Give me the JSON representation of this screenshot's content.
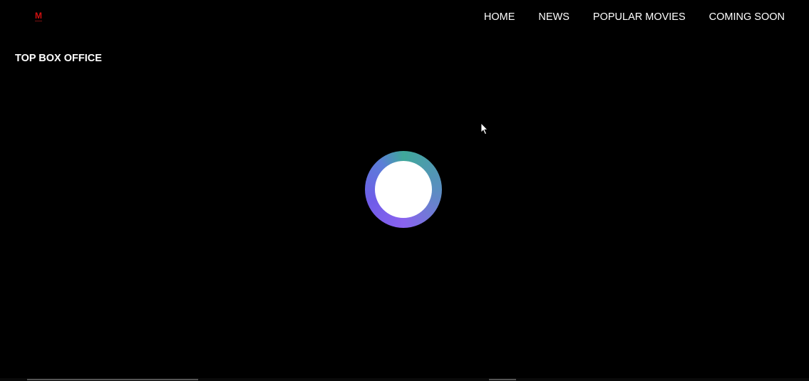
{
  "brand": {
    "logo_text": "M",
    "logo_color": "#d01010"
  },
  "nav": {
    "items": [
      {
        "label": "HOME"
      },
      {
        "label": "NEWS"
      },
      {
        "label": "POPULAR MOVIES"
      },
      {
        "label": "COMING SOON"
      }
    ]
  },
  "main": {
    "section_title": "TOP BOX OFFICE"
  },
  "loader": {
    "icon": "loading-spinner-icon",
    "gradient_colors": [
      "#3fa89a",
      "#5a8ec0",
      "#8a63ef",
      "#6f5ce8"
    ]
  },
  "theme": {
    "background": "#000000",
    "text": "#ffffff"
  }
}
